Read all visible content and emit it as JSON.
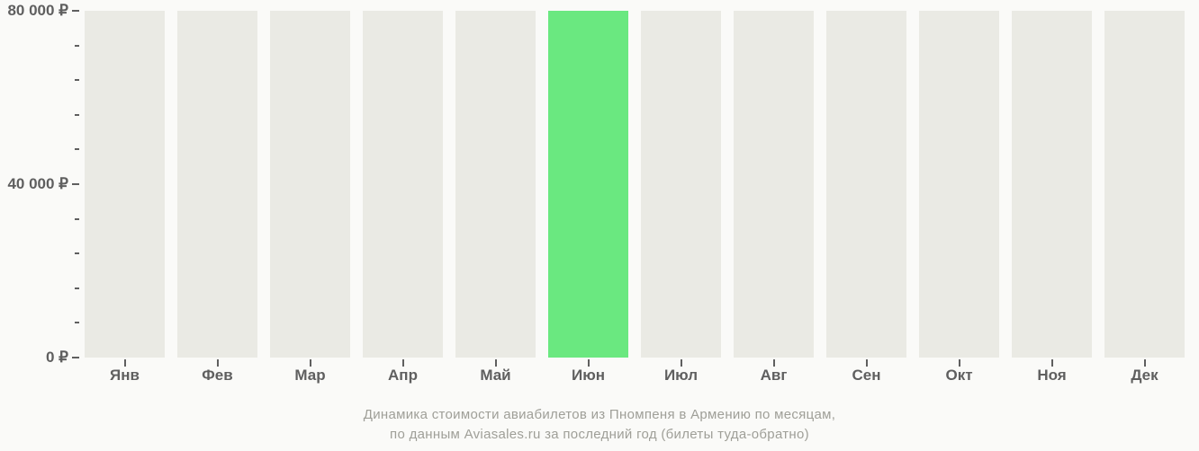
{
  "chart_data": {
    "type": "bar",
    "categories": [
      "Янв",
      "Фев",
      "Мар",
      "Апр",
      "Май",
      "Июн",
      "Июл",
      "Авг",
      "Сен",
      "Окт",
      "Ноя",
      "Дек"
    ],
    "values": [
      null,
      null,
      null,
      null,
      null,
      80000,
      null,
      null,
      null,
      null,
      null,
      null
    ],
    "ylabel": "",
    "xlabel": "",
    "ylim": [
      0,
      80000
    ],
    "y_ticks_major": [
      {
        "value": 0,
        "label": "0 ₽"
      },
      {
        "value": 40000,
        "label": "40 000 ₽"
      },
      {
        "value": 80000,
        "label": "80 000 ₽"
      }
    ],
    "y_ticks_minor": [
      8000,
      16000,
      24000,
      32000,
      48000,
      56000,
      64000,
      72000
    ],
    "title": "Динамика стоимости авиабилетов из Пномпеня в Армению по месяцам,",
    "subtitle": "по данным Aviasales.ru за последний год (билеты туда-обратно)",
    "currency": "₽",
    "highlight_color": "#6ae880",
    "bg_bar_color": "#eaeae4"
  }
}
